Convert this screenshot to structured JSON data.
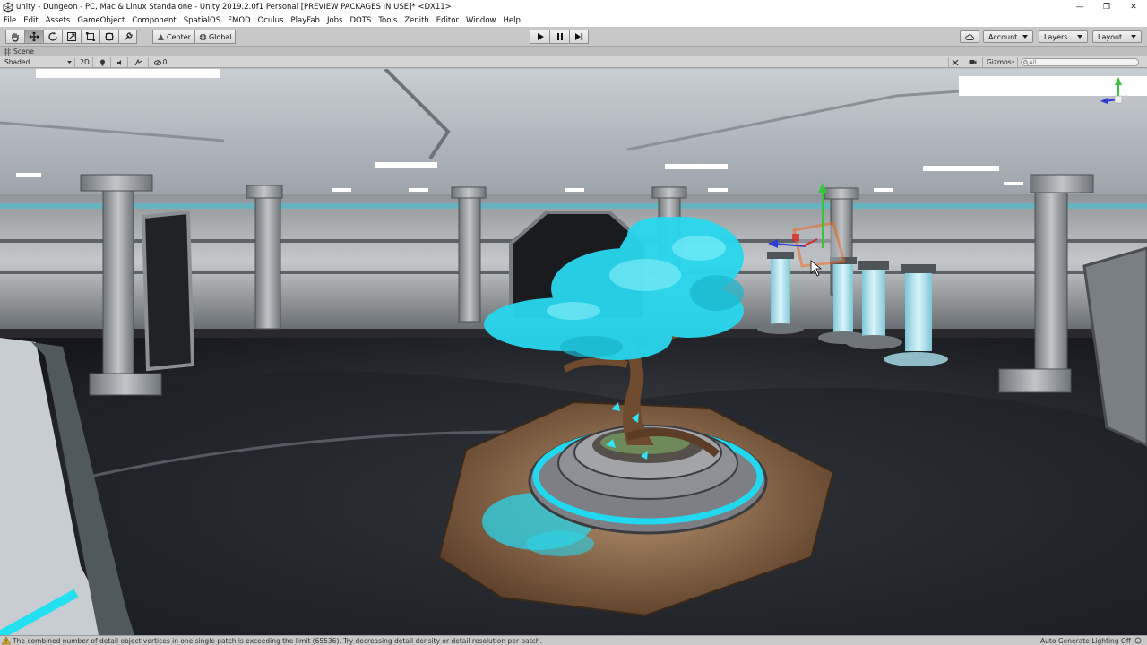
{
  "window": {
    "title": "unity - Dungeon - PC, Mac & Linux Standalone - Unity 2019.2.0f1 Personal [PREVIEW PACKAGES IN USE]* <DX11>",
    "minimize": "—",
    "maximize": "❐",
    "close": "✕"
  },
  "menu": [
    "File",
    "Edit",
    "Assets",
    "GameObject",
    "Component",
    "SpatialOS",
    "FMOD",
    "Oculus",
    "PlayFab",
    "Jobs",
    "DOTS",
    "Tools",
    "Zenith",
    "Editor",
    "Window",
    "Help"
  ],
  "toolbar": {
    "pivot_mode": "Center",
    "pivot_rotation": "Global",
    "account": "Account",
    "layers": "Layers",
    "layout": "Layout"
  },
  "scene_tab": {
    "label": "Scene"
  },
  "scene_toolbar": {
    "shading": "Shaded",
    "mode_2d": "2D",
    "hidden_count": "0",
    "gizmos": "Gizmos",
    "search_placeholder": "All"
  },
  "status": {
    "message": "The combined number of detail object vertices in one single patch is exceeding the limit (65536). Try decreasing detail density or detail resolution per patch.",
    "lighting": "Auto Generate Lighting Off"
  },
  "colors": {
    "glow": "#22d8ee",
    "selection": "#f06a1e",
    "play_accent": "#111111"
  }
}
